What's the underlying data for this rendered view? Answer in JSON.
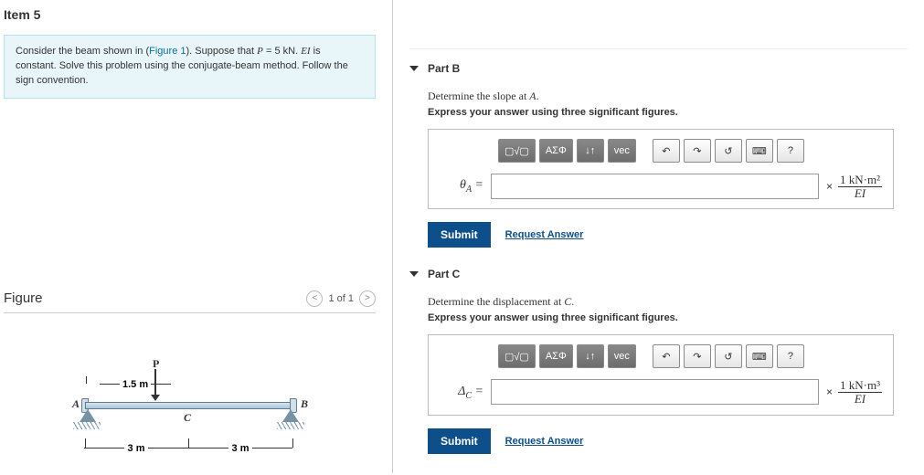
{
  "item_title": "Item 5",
  "intro": {
    "pre": "Consider the beam shown in (",
    "fig_link": "Figure 1",
    "mid1": "). Suppose that ",
    "eq1_lhs": "P",
    "eq1_rhs": " = 5 kN",
    "mid2": ". ",
    "eq2": "EI",
    "post": " is constant. Solve this problem using the conjugate-beam method. Follow the sign convention."
  },
  "figure": {
    "title": "Figure",
    "pager": "1 of 1",
    "labels": {
      "P": "P",
      "A": "A",
      "B": "B",
      "C": "C"
    },
    "dims": {
      "top": "1.5 m",
      "left": "3 m",
      "right": "3 m"
    }
  },
  "parts": [
    {
      "name": "Part B",
      "prompt_pre": "Determine the slope at ",
      "prompt_var": "A",
      "prompt_post": ".",
      "instruction": "Express your answer using three significant figures.",
      "var_html": "θ<sub>A</sub> =",
      "unit_num": "1 kN·m²",
      "unit_den": "EI",
      "submit": "Submit",
      "request": "Request Answer",
      "toolbar": {
        "templates": "▢√▢",
        "greek": "ΑΣΦ",
        "sort": "↓↑",
        "vec": "vec",
        "help": "?"
      }
    },
    {
      "name": "Part C",
      "prompt_pre": "Determine the displacement at ",
      "prompt_var": "C",
      "prompt_post": ".",
      "instruction": "Express your answer using three significant figures.",
      "var_html": "Δ<sub>C</sub> =",
      "unit_num": "1 kN·m³",
      "unit_den": "EI",
      "submit": "Submit",
      "request": "Request Answer",
      "toolbar": {
        "templates": "▢√▢",
        "greek": "ΑΣΦ",
        "sort": "↓↑",
        "vec": "vec",
        "help": "?"
      }
    }
  ]
}
